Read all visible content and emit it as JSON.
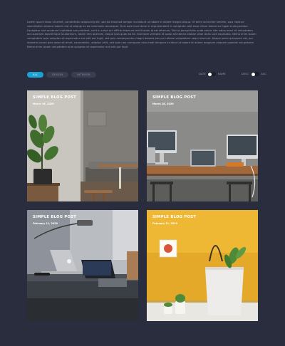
{
  "intro_text": "Lorem ipsum dolor sit amet, consectetur adipiscing elit, sed do eiusmod tempor incididunt ut labore et dolore magna aliqua. Ut enim ad minim veniam, quis nostrud exercitation ullamco laboris nisi ut aliquip ex ea commodo consequat. Duis aute irure dolor in reprehenderit in voluptate velit esse cillum dolore eu fugiat nulla pariatur. Excepteur sint occaecat cupidatat non proident, sunt in culpa qui officia deserunt mollit anim id est laborum. Sed ut perspiciatis unde omnis iste natus error sit voluptatem accusantium doloremque laudantium, totam rem aperiam, eaque ipsa quae ab illo inventore veritatis et quasi architecto beatae vitae dicta sunt explicabo. Nemo enim ipsam voluptatem quia voluptas sit aspernatur aut odit aut fugit, sed quia consequuntur magni dolores eos qui ratione voluptatem sequi nesciunt. Neque porro quisquam est, qui dolorem ipsum quia dolor sit amet, consectetur, adipisci velit, sed quia non numquam eius modi tempora incidunt ut labore et dolore magnam aliquam quaerat voluptatem. Nemo enim ipsam voluptatem quia voluptas sit aspernatur aut odit aut fugit.",
  "filters": [
    {
      "label": "All",
      "active": true
    },
    {
      "label": "Design",
      "active": false
    },
    {
      "label": "Interior",
      "active": false
    }
  ],
  "sorts": [
    {
      "label_left": "Date",
      "label_right": "Name"
    },
    {
      "label_left": "Desc",
      "label_right": "Asc"
    }
  ],
  "posts": [
    {
      "title": "Simple Blog Post",
      "date": "March 16, 2020"
    },
    {
      "title": "Simple Blog Post",
      "date": "March 16, 2020"
    },
    {
      "title": "Simple Blog Post",
      "date": "February 11, 2020"
    },
    {
      "title": "Simple Blog Post",
      "date": "February 11, 2020"
    }
  ],
  "colors": {
    "background": "#2a2d3d",
    "accent": "#1aa3d4",
    "pill_idle": "#3a3d4f"
  }
}
